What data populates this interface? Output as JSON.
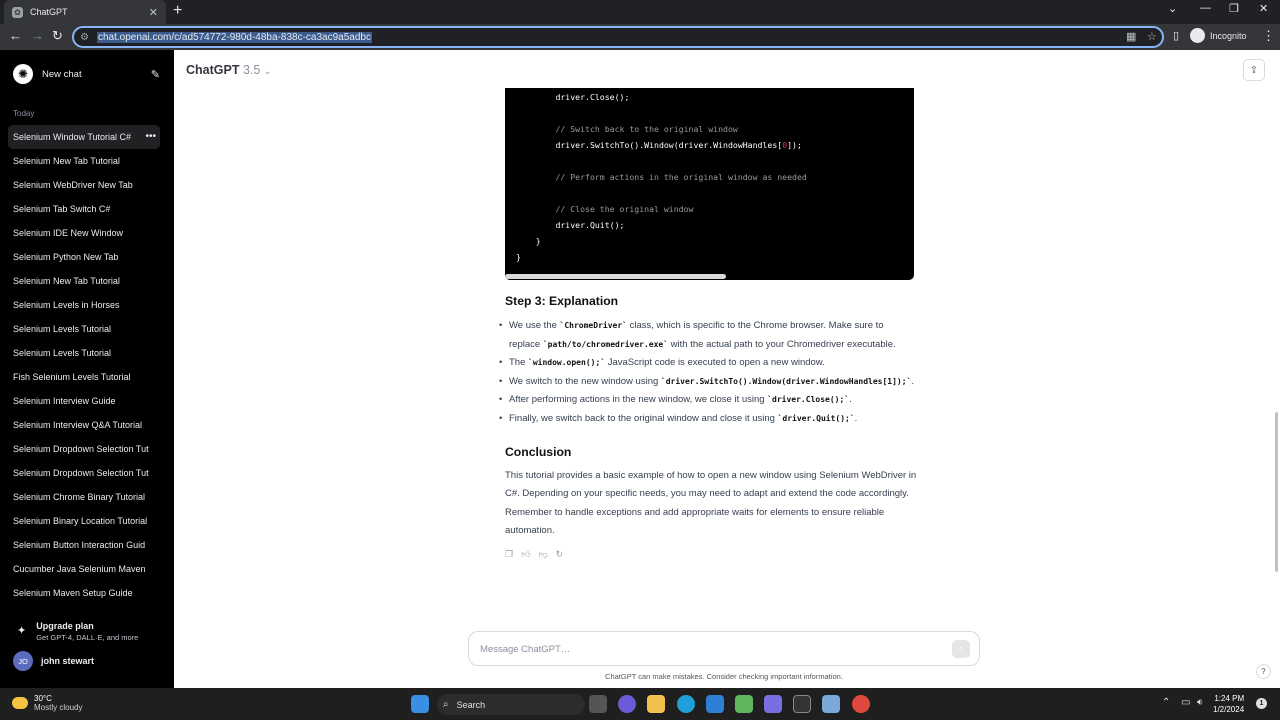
{
  "browser": {
    "tab_title": "ChatGPT",
    "url": "chat.openai.com/c/ad574772-980d-48ba-838c-ca3ac9a5adbc",
    "profile_label": "Incognito"
  },
  "sidebar": {
    "new_chat_label": "New chat",
    "section_label": "Today",
    "history": [
      "Selenium Window Tutorial C#",
      "Selenium New Tab Tutorial",
      "Selenium WebDriver New Tab",
      "Selenium Tab Switch C#",
      "Selenium IDE New Window",
      "Selenium Python New Tab",
      "Selenium New Tab Tutorial",
      "Selenium Levels in Horses",
      "Selenium Levels Tutorial",
      "Selenium Levels Tutorial",
      "Fish Selenium Levels Tutorial",
      "Selenium Interview Guide",
      "Selenium Interview Q&A Tutorial",
      "Selenium Dropdown Selection Tut",
      "Selenium Dropdown Selection Tut",
      "Selenium Chrome Binary Tutorial",
      "Selenium Binary Location Tutorial",
      "Selenium Button Interaction Guid",
      "Cucumber Java Selenium Maven",
      "Selenium Maven Setup Guide"
    ],
    "upgrade_title": "Upgrade plan",
    "upgrade_subtitle": "Get GPT-4, DALL·E, and more",
    "user_initials": "JO",
    "user_name": "john stewart"
  },
  "header": {
    "model_name": "ChatGPT",
    "model_version": "3.5"
  },
  "code_block": {
    "lines": [
      {
        "indent": "        ",
        "text": "driver.Close();"
      },
      {
        "indent": "",
        "text": ""
      },
      {
        "indent": "        ",
        "text": "// Switch back to the original window",
        "comment": true
      },
      {
        "indent": "        ",
        "text": "driver.SwitchTo().Window(driver.WindowHandles[",
        "num": "0",
        "after": "]);"
      },
      {
        "indent": "",
        "text": ""
      },
      {
        "indent": "        ",
        "text": "// Perform actions in the original window as needed",
        "comment": true
      },
      {
        "indent": "",
        "text": ""
      },
      {
        "indent": "        ",
        "text": "// Close the original window",
        "comment": true
      },
      {
        "indent": "        ",
        "text": "driver.Quit();"
      },
      {
        "indent": "    ",
        "text": "}"
      },
      {
        "indent": "",
        "text": "}"
      }
    ]
  },
  "explanation": {
    "heading": "Step 3: Explanation",
    "bullets": [
      [
        {
          "t": "We use the "
        },
        {
          "c": "`ChromeDriver`"
        },
        {
          "t": " class, which is specific to the Chrome browser. Make sure to replace "
        },
        {
          "c": "`path/to/chromedriver.exe`"
        },
        {
          "t": " with the actual path to your Chromedriver executable."
        }
      ],
      [
        {
          "t": "The "
        },
        {
          "c": "`window.open();`"
        },
        {
          "t": " JavaScript code is executed to open a new window."
        }
      ],
      [
        {
          "t": "We switch to the new window using "
        },
        {
          "c": "`driver.SwitchTo().Window(driver.WindowHandles[1]);`"
        },
        {
          "t": "."
        }
      ],
      [
        {
          "t": "After performing actions in the new window, we close it using "
        },
        {
          "c": "`driver.Close();`"
        },
        {
          "t": "."
        }
      ],
      [
        {
          "t": "Finally, we switch back to the original window and close it using "
        },
        {
          "c": "`driver.Quit();`"
        },
        {
          "t": "."
        }
      ]
    ]
  },
  "conclusion": {
    "heading": "Conclusion",
    "text": "This tutorial provides a basic example of how to open a new window using Selenium WebDriver in C#. Depending on your specific needs, you may need to adapt and extend the code accordingly. Remember to handle exceptions and add appropriate waits for elements to ensure reliable automation."
  },
  "composer": {
    "placeholder": "Message ChatGPT…",
    "disclaimer": "ChatGPT can make mistakes. Consider checking important information."
  },
  "taskbar": {
    "temperature": "30°C",
    "weather": "Mostly cloudy",
    "search_label": "Search",
    "time": "1:24 PM",
    "date": "1/2/2024",
    "notification_count": "1"
  }
}
